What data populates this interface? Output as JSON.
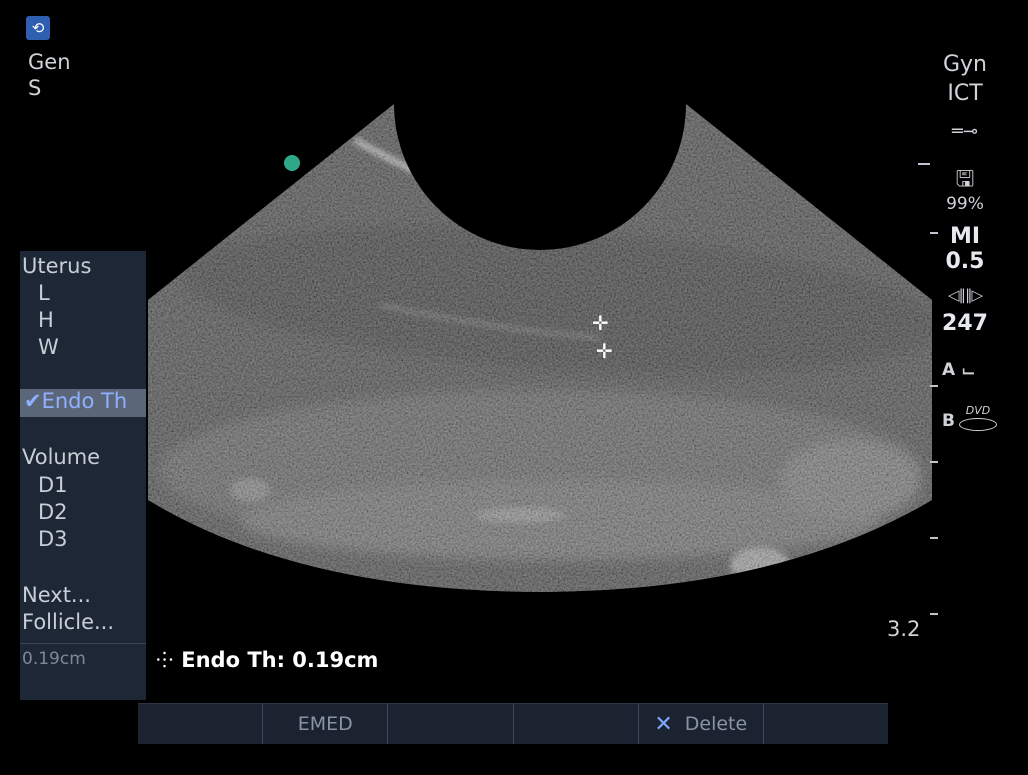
{
  "header": {
    "logo_icon": "swirl-logo-icon",
    "mode": "Gen",
    "submode": "S"
  },
  "left_panel": {
    "group1_title": "Uterus",
    "group1_items": [
      "L",
      "H",
      "W"
    ],
    "selected": "✔Endo Th",
    "group2_title": "Volume",
    "group2_items": [
      "D1",
      "D2",
      "D3"
    ],
    "next": "Next...",
    "follicle": "Follicle...",
    "result": "0.19cm"
  },
  "right_panel": {
    "preset": "Gyn",
    "probe": "ICT",
    "probe_icon": "probe-icon",
    "storage_icon": "disk-icon",
    "storage_pct": "99%",
    "mi_label": "MI",
    "mi_value": "0.5",
    "frame_icon": "cine-frames-icon",
    "frame_value": "247",
    "a_label": "A",
    "a_icon": "print-icon",
    "b_label": "B",
    "b_icon": "dvd-icon",
    "b_icon_text": "DVD"
  },
  "image": {
    "marker_color": "#2fa88a",
    "depth_scale": "3.2"
  },
  "measurement": {
    "readout": "Endo Th: 0.19cm"
  },
  "softkeys": [
    "",
    "EMED",
    "",
    "",
    "Delete",
    ""
  ]
}
